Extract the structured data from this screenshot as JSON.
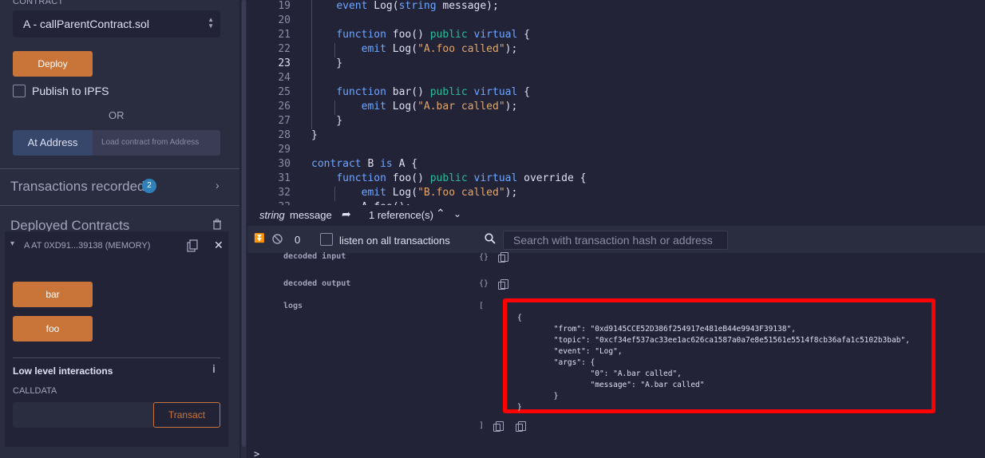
{
  "left": {
    "contract_label": "CONTRACT",
    "contract_selected": "A - callParentContract.sol",
    "deploy_label": "Deploy",
    "publish_label": "Publish to IPFS",
    "or_label": "OR",
    "at_address_label": "At Address",
    "load_placeholder": "Load contract from Address",
    "transactions_label": "Transactions recorded",
    "transactions_count": "2",
    "deployed_label": "Deployed Contracts",
    "instance_title": "A AT 0XD91...39138 (MEMORY)",
    "fn_buttons": [
      "bar",
      "foo"
    ],
    "low_level_title": "Low level interactions",
    "calldata_label": "CALLDATA",
    "transact_label": "Transact"
  },
  "editor": {
    "line_numbers": [
      "19",
      "20",
      "21",
      "22",
      "23",
      "24",
      "25",
      "26",
      "27",
      "28",
      "29",
      "30",
      "31",
      "32",
      "33"
    ],
    "active_line": "23"
  },
  "refbar": {
    "type": "string",
    "name": "message",
    "references": "1 reference(s)"
  },
  "terminal": {
    "pending_count": "0",
    "listen_label": "listen on all transactions",
    "search_placeholder": "Search with transaction hash or address",
    "decoded_input_label": "decoded input",
    "decoded_input_value": "{}",
    "decoded_output_label": "decoded output",
    "decoded_output_value": "{}",
    "logs_label": "logs",
    "logs_open": "[",
    "logs_close": "]",
    "log_lines": [
      "{",
      "        \"from\": \"0xd9145CCE52D386f254917e481eB44e9943F39138\",",
      "        \"topic\": \"0xcf34ef537ac33ee1ac626ca1587a0a7e8e51561e5514f8cb36afa1c5102b3bab\",",
      "        \"event\": \"Log\",",
      "        \"args\": {",
      "                \"0\": \"A.bar called\",",
      "                \"message\": \"A.bar called\"",
      "        }",
      "}"
    ],
    "prompt": ">"
  },
  "colors": {
    "accent_orange": "#c97539",
    "highlight_red": "#ff0000",
    "background": "#222336",
    "panel": "#2a2c3f"
  }
}
